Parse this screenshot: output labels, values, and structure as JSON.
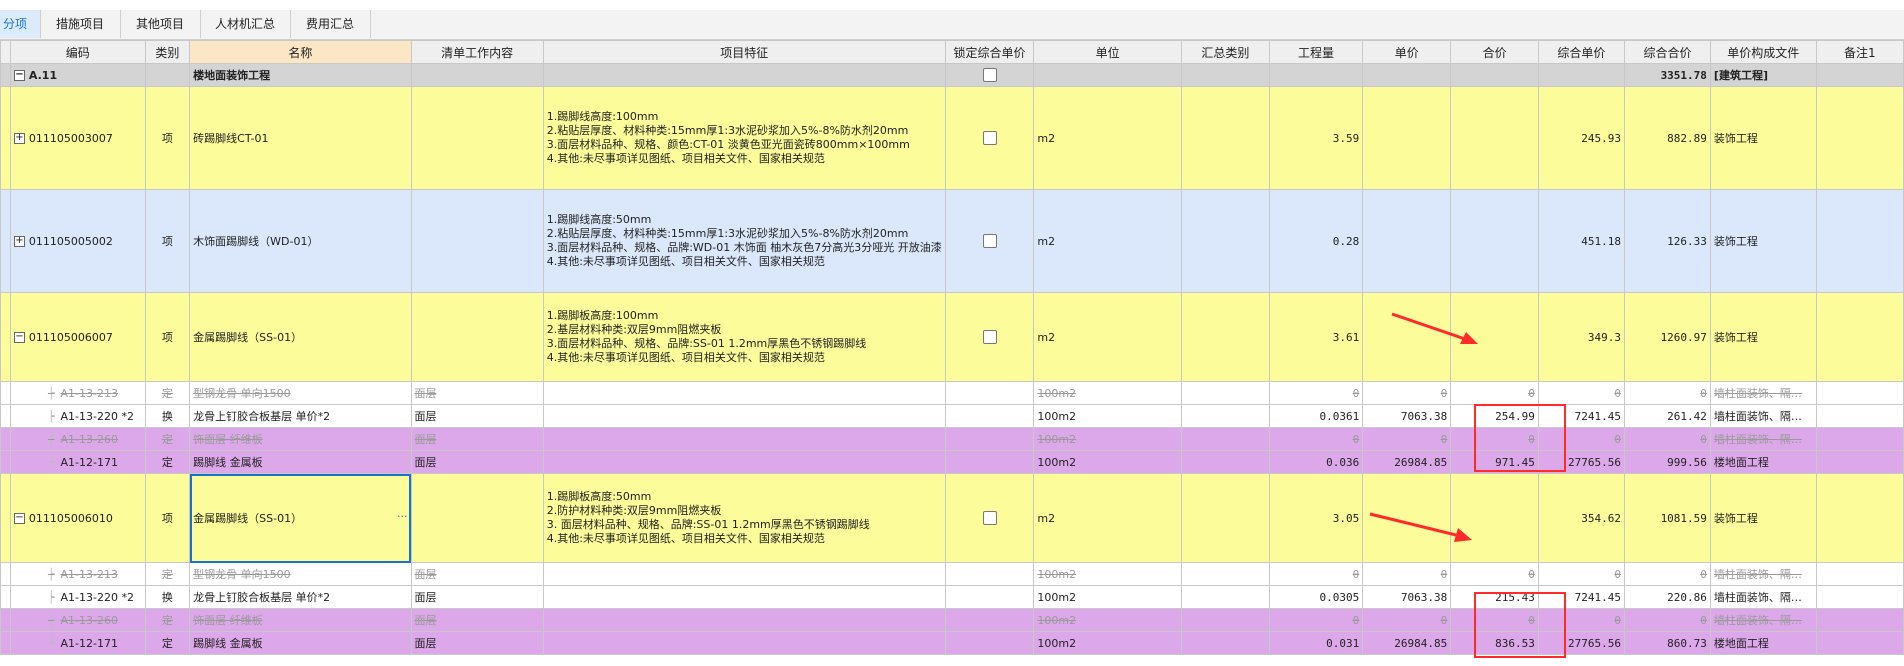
{
  "tabs": [
    "分项",
    "措施项目",
    "其他项目",
    "人材机汇总",
    "费用汇总"
  ],
  "columns": [
    "编码",
    "类别",
    "名称",
    "清单工作内容",
    "项目特征",
    "锁定综合单价",
    "单位",
    "汇总类别",
    "工程量",
    "单价",
    "合价",
    "综合单价",
    "综合合价",
    "单价构成文件",
    "备注1"
  ],
  "group": {
    "code": "A.11",
    "name": "楼地面装饰工程",
    "total": "3351.78",
    "file": "[建筑工程]"
  },
  "items": [
    {
      "code": "011105003007",
      "type": "项",
      "name": "砖踢脚线CT-01",
      "features": [
        "1.踢脚线高度:100mm",
        "2.粘贴层厚度、材料种类:15mm厚1:3水泥砂浆加入5%-8%防水剂20mm",
        "3.面层材料品种、规格、颜色:CT-01 淡黄色亚光面瓷砖800mm×100mm",
        "4.其他:未尽事项详见图纸、项目相关文件、国家相关规范"
      ],
      "unit": "m2",
      "qty": "3.59",
      "unit_price_total": "245.93",
      "sum_total": "882.89",
      "file": "装饰工程"
    },
    {
      "code": "011105005002",
      "type": "项",
      "name": "木饰面踢脚线（WD-01）",
      "features": [
        "1.踢脚线高度:50mm",
        "2.粘贴层厚度、材料种类:15mm厚1:3水泥砂浆加入5%-8%防水剂20mm",
        "3.面层材料品种、规格、品牌:WD-01 木饰面 柚木灰色7分高光3分哑光 开放油漆",
        "4.其他:未尽事项详见图纸、项目相关文件、国家相关规范"
      ],
      "unit": "m2",
      "qty": "0.28",
      "unit_price_total": "451.18",
      "sum_total": "126.33",
      "file": "装饰工程"
    },
    {
      "code": "011105006007",
      "type": "项",
      "name": "金属踢脚线（SS-01）",
      "features": [
        "1.踢脚板高度:100mm",
        "2.基层材料种类:双层9mm阻燃夹板",
        "3.面层材料品种、规格、品牌:SS-01 1.2mm厚黑色不锈钢踢脚线",
        "4.其他:未尽事项详见图纸、项目相关文件、国家相关规范"
      ],
      "unit": "m2",
      "qty": "3.61",
      "unit_price_total": "349.3",
      "sum_total": "1260.97",
      "file": "装饰工程"
    },
    {
      "code": "011105006010",
      "type": "项",
      "name": "金属踢脚线（SS-01）",
      "features": [
        "1.踢脚板高度:50mm",
        "2.防护材料种类:双层9mm阻燃夹板",
        "3. 面层材料品种、规格、品牌:SS-01 1.2mm厚黑色不锈钢踢脚线",
        "4.其他:未尽事项详见图纸、项目相关文件、国家相关规范"
      ],
      "unit": "m2",
      "qty": "3.05",
      "unit_price_total": "354.62",
      "sum_total": "1081.59",
      "file": "装饰工程"
    }
  ],
  "subrows_a": [
    {
      "code": "A1-13-213",
      "type": "定",
      "name": "型钢龙骨 单向1500",
      "work": "面层",
      "unit": "100m2",
      "qty": "0",
      "price": "0",
      "sum": "0",
      "uprice": "0",
      "usum": "0",
      "file": "墙柱面装饰、隔…",
      "style": "strike"
    },
    {
      "code": "A1-13-220 *2",
      "type": "换",
      "name": "龙骨上钉胶合板基层   单价*2",
      "work": "面层",
      "unit": "100m2",
      "qty": "0.0361",
      "price": "7063.38",
      "sum": "254.99",
      "uprice": "7241.45",
      "usum": "261.42",
      "file": "墙柱面装饰、隔…",
      "style": "white"
    },
    {
      "code": "A1-13-260",
      "type": "定",
      "name": "饰面层 纤维板",
      "work": "面层",
      "unit": "100m2",
      "qty": "0",
      "price": "0",
      "sum": "0",
      "uprice": "0",
      "usum": "0",
      "file": "墙柱面装饰、隔…",
      "style": "strike-purple"
    },
    {
      "code": "A1-12-171",
      "type": "定",
      "name": "踢脚线 金属板",
      "work": "面层",
      "unit": "100m2",
      "qty": "0.036",
      "price": "26984.85",
      "sum": "971.45",
      "uprice": "27765.56",
      "usum": "999.56",
      "file": "楼地面工程",
      "style": "purple"
    }
  ],
  "subrows_b": [
    {
      "code": "A1-13-213",
      "type": "定",
      "name": "型钢龙骨 单向1500",
      "work": "面层",
      "unit": "100m2",
      "qty": "0",
      "price": "0",
      "sum": "0",
      "uprice": "0",
      "usum": "0",
      "file": "墙柱面装饰、隔…",
      "style": "strike"
    },
    {
      "code": "A1-13-220 *2",
      "type": "换",
      "name": "龙骨上钉胶合板基层   单价*2",
      "work": "面层",
      "unit": "100m2",
      "qty": "0.0305",
      "price": "7063.38",
      "sum": "215.43",
      "uprice": "7241.45",
      "usum": "220.86",
      "file": "墙柱面装饰、隔…",
      "style": "white"
    },
    {
      "code": "A1-13-260",
      "type": "定",
      "name": "饰面层 纤维板",
      "work": "面层",
      "unit": "100m2",
      "qty": "0",
      "price": "0",
      "sum": "0",
      "uprice": "0",
      "usum": "0",
      "file": "墙柱面装饰、隔…",
      "style": "strike-purple"
    },
    {
      "code": "A1-12-171",
      "type": "定",
      "name": "踢脚线 金属板",
      "work": "面层",
      "unit": "100m2",
      "qty": "0.031",
      "price": "26984.85",
      "sum": "836.53",
      "uprice": "27765.56",
      "usum": "860.73",
      "file": "楼地面工程",
      "style": "purple"
    }
  ],
  "accent_color": "#ff2a2a"
}
